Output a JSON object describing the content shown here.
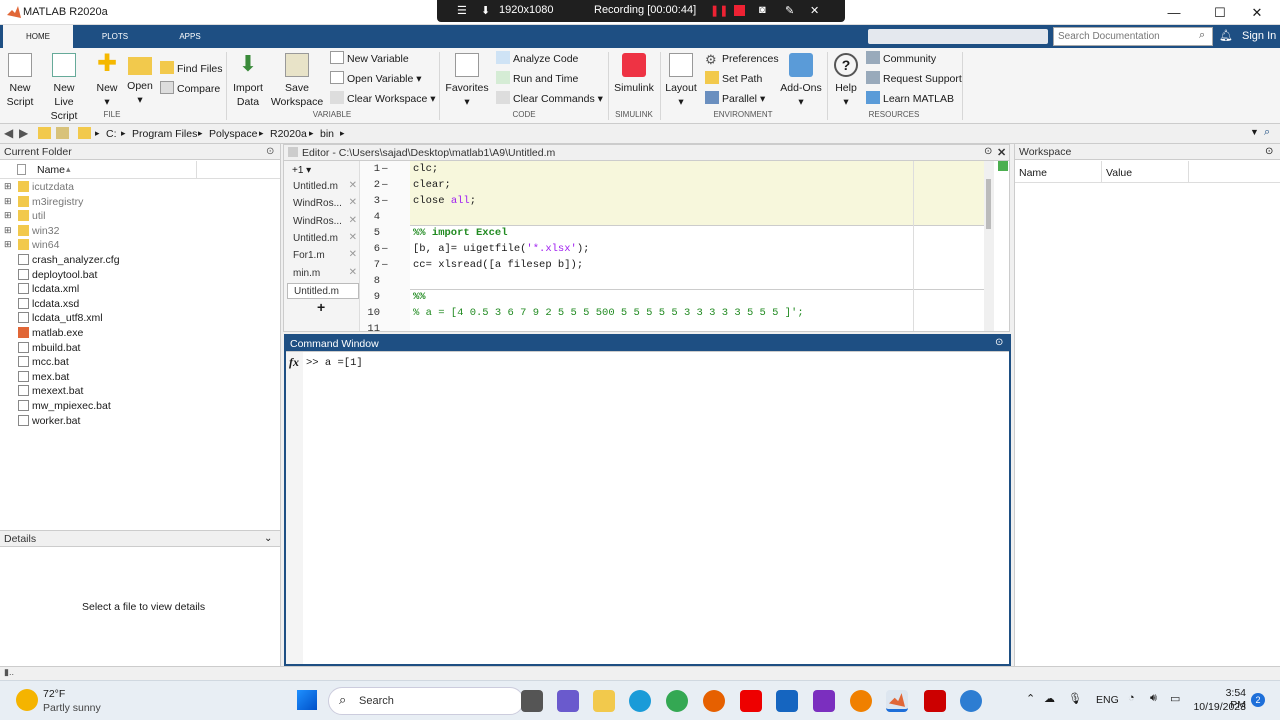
{
  "window": {
    "title": "MATLAB R2020a",
    "minimize": "—",
    "maximize": "☐",
    "close": "✕"
  },
  "recording": {
    "resolution": "1920x1080",
    "status": "Recording [00:00:44]"
  },
  "tabs": [
    {
      "label": "HOME"
    },
    {
      "label": "PLOTS"
    },
    {
      "label": "APPS"
    }
  ],
  "search": {
    "placeholder": "Search Documentation",
    "signin": "Sign In"
  },
  "ribbon": {
    "file": {
      "group": "FILE",
      "new_script": [
        "New",
        "Script"
      ],
      "new_live": [
        "New",
        "Live Script"
      ],
      "new": "New",
      "open": "Open",
      "find_files": "Find Files",
      "compare": "Compare"
    },
    "variable": {
      "group": "VARIABLE",
      "import": [
        "Import",
        "Data"
      ],
      "save": [
        "Save",
        "Workspace"
      ],
      "new_variable": "New Variable",
      "open_variable": "Open Variable",
      "clear_workspace": "Clear Workspace"
    },
    "code": {
      "group": "CODE",
      "favorites": "Favorites",
      "analyze": "Analyze Code",
      "run_time": "Run and Time",
      "clear_commands": "Clear Commands"
    },
    "simulink": {
      "group": "SIMULINK",
      "label": "Simulink"
    },
    "environment": {
      "group": "ENVIRONMENT",
      "layout": "Layout",
      "preferences": "Preferences",
      "set_path": "Set Path",
      "parallel": "Parallel",
      "addons": "Add-Ons"
    },
    "resources": {
      "group": "RESOURCES",
      "help": "Help",
      "community": "Community",
      "request_support": "Request Support",
      "learn": "Learn MATLAB"
    }
  },
  "address": {
    "crumbs": [
      "C:",
      "Program Files",
      "Polyspace",
      "R2020a",
      "bin"
    ]
  },
  "current_folder": {
    "title": "Current Folder",
    "column": "Name",
    "sort": "▴",
    "items": [
      {
        "name": "icutzdata",
        "type": "folder"
      },
      {
        "name": "m3iregistry",
        "type": "folder"
      },
      {
        "name": "util",
        "type": "folder"
      },
      {
        "name": "win32",
        "type": "folder"
      },
      {
        "name": "win64",
        "type": "folder"
      },
      {
        "name": "crash_analyzer.cfg",
        "type": "file"
      },
      {
        "name": "deploytool.bat",
        "type": "file"
      },
      {
        "name": "lcdata.xml",
        "type": "file"
      },
      {
        "name": "lcdata.xsd",
        "type": "file"
      },
      {
        "name": "lcdata_utf8.xml",
        "type": "file"
      },
      {
        "name": "matlab.exe",
        "type": "exe"
      },
      {
        "name": "mbuild.bat",
        "type": "file"
      },
      {
        "name": "mcc.bat",
        "type": "file"
      },
      {
        "name": "mex.bat",
        "type": "file"
      },
      {
        "name": "mexext.bat",
        "type": "file"
      },
      {
        "name": "mw_mpiexec.bat",
        "type": "file"
      },
      {
        "name": "worker.bat",
        "type": "file"
      }
    ]
  },
  "details": {
    "title": "Details",
    "empty": "Select a file to view details"
  },
  "editor": {
    "title": "Editor - C:\\Users\\sajad\\Desktop\\matlab1\\A9\\Untitled.m",
    "counter": "+1",
    "add": "+",
    "files": [
      {
        "name": "Untitled.m"
      },
      {
        "name": "WindRos..."
      },
      {
        "name": "WindRos..."
      },
      {
        "name": "Untitled.m"
      },
      {
        "name": "For1.m"
      },
      {
        "name": "min.m"
      },
      {
        "name": "Untitled.m"
      }
    ],
    "lines": [
      {
        "n": "1",
        "d": "–",
        "a": "clc;",
        "b": ""
      },
      {
        "n": "2",
        "d": "–",
        "a": "clear;",
        "b": ""
      },
      {
        "n": "3",
        "d": "–",
        "a": "close ",
        "b": "all",
        "c": ";"
      },
      {
        "n": "4",
        "d": "",
        "a": "",
        "b": ""
      },
      {
        "n": "5",
        "d": "",
        "a": "%% import Excel",
        "b": ""
      },
      {
        "n": "6",
        "d": "–",
        "a": "[b, a]= uigetfile(",
        "b": "'*.xlsx'",
        "c": ");"
      },
      {
        "n": "7",
        "d": "–",
        "a": "cc= xlsread([a filesep b]);",
        "b": ""
      },
      {
        "n": "8",
        "d": "",
        "a": "",
        "b": ""
      },
      {
        "n": "9",
        "d": "",
        "a": "%%",
        "b": ""
      },
      {
        "n": "10",
        "d": "",
        "a": "% a = [4 0.5 3 6 7 9 2 5 5 5 500 5 5 5 5 5 3 3 3 3 3 5 5 5 ]';",
        "b": ""
      },
      {
        "n": "11",
        "d": "",
        "a": "",
        "b": ""
      }
    ]
  },
  "command": {
    "title": "Command Window",
    "fx": "fx",
    "prompt": ">> a =[1]"
  },
  "workspace": {
    "title": "Workspace",
    "col_name": "Name",
    "col_value": "Value"
  },
  "taskbar": {
    "temp": "72°F",
    "weather": "Partly sunny",
    "search": "Search",
    "lang": "ENG",
    "time": "3:54 PM",
    "date": "10/19/2023",
    "badge": "2"
  },
  "colors": {
    "accent": "#1e4f83",
    "editor_highlight": "#f7f7dc"
  }
}
